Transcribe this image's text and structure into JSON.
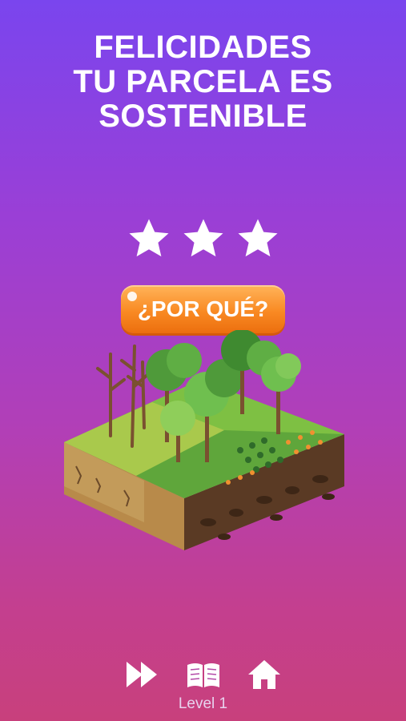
{
  "title": {
    "line1": "FELICIDADES",
    "line2": "TU PARCELA ES",
    "line3": "SOSTENIBLE"
  },
  "rating": {
    "stars_earned": 3,
    "stars_total": 3
  },
  "why_button": {
    "label": "¿POR QUÉ?"
  },
  "footer": {
    "level_label": "Level 1",
    "icons": [
      "fast-forward-icon",
      "book-icon",
      "home-icon"
    ]
  },
  "colors": {
    "bg_top": "#7a45ee",
    "bg_bottom": "#c8407c",
    "button": "#f98a23",
    "grass": "#6fae3c",
    "soil": "#5a3a24"
  }
}
